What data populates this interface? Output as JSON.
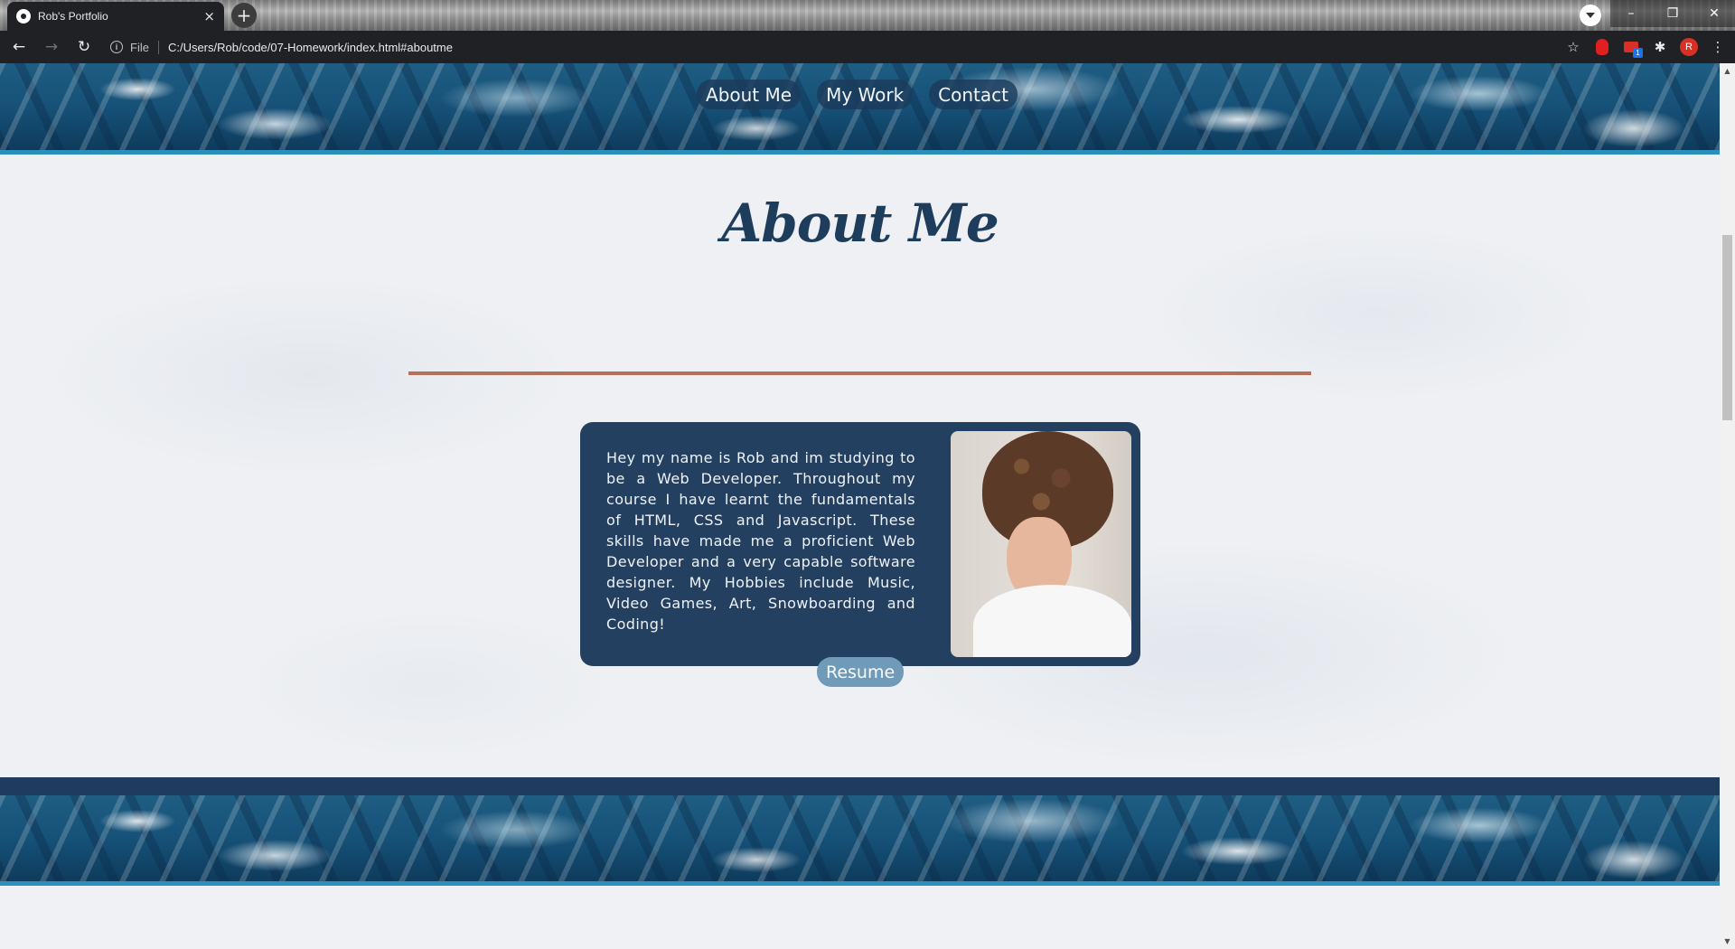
{
  "browser": {
    "tab_title": "Rob's Portfolio",
    "tab_close": "×",
    "new_tab": "+",
    "scheme_label": "File",
    "url": "C:/Users/Rob/code/07-Homework/index.html#aboutme",
    "avatar_initial": "R",
    "extension_badge": "1",
    "window_controls": {
      "minimize": "–",
      "restore": "❐",
      "close": "✕"
    },
    "nav": {
      "back": "←",
      "forward": "→",
      "reload": "↻"
    },
    "toolbar_icons": {
      "bookmark": "☆",
      "extensions": "✱",
      "menu": "⋮"
    }
  },
  "site_nav": {
    "items": [
      {
        "label": "About Me"
      },
      {
        "label": "My Work"
      },
      {
        "label": "Contact"
      }
    ]
  },
  "about": {
    "title": "About Me",
    "paragraph": "Hey my name is Rob and im studying to be a Web Developer. Throughout my course I have learnt the fundamentals of HTML, CSS and Javascript. These skills have made me a proficient Web Developer and a very capable software designer. My Hobbies include Music, Video Games, Art, Snowboarding and Coding!",
    "resume_label": "Resume"
  },
  "scrollbar": {
    "up": "▲",
    "down": "▼"
  },
  "colors": {
    "navy": "#234060",
    "accent_rule": "#b86f5a",
    "border_blue": "#2b8fbd",
    "resume_button": "#6f9ab8"
  }
}
